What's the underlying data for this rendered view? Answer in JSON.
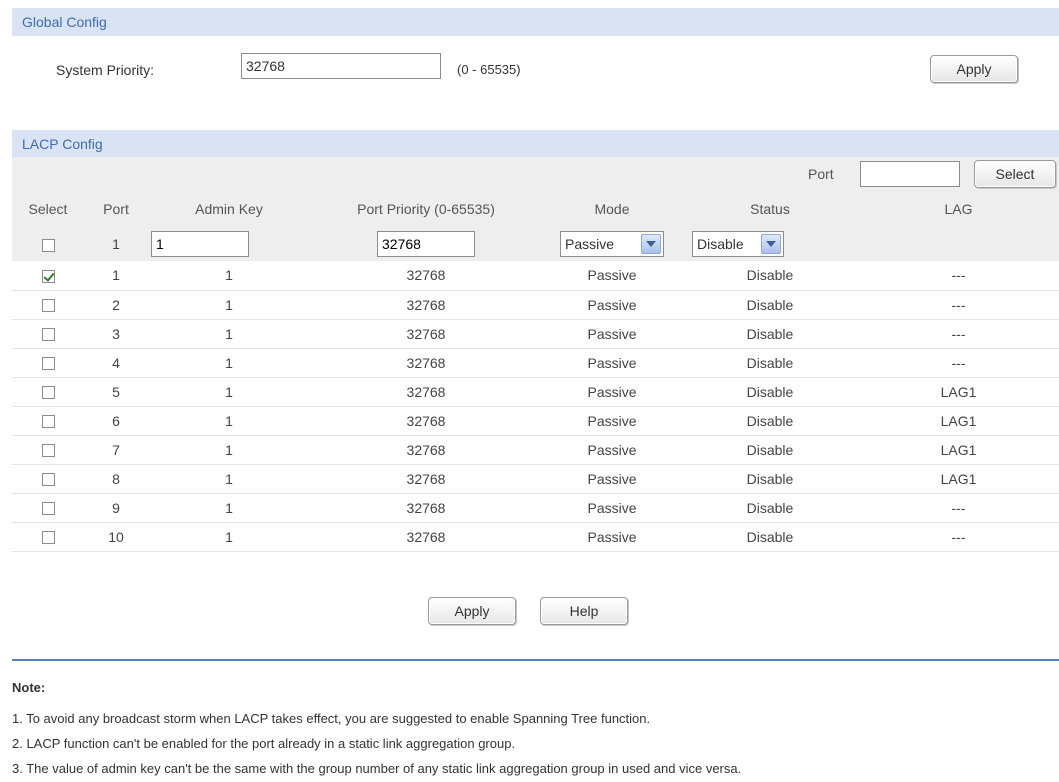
{
  "global": {
    "header": "Global Config",
    "priority_label": "System Priority:",
    "priority_value": "32768",
    "priority_range": "(0 - 65535)",
    "apply_label": "Apply"
  },
  "lacp": {
    "header": "LACP Config",
    "port_filter_label": "Port",
    "port_filter_value": "",
    "select_button": "Select",
    "columns": [
      "Select",
      "Port",
      "Admin Key",
      "Port Priority (0-65535)",
      "Mode",
      "Status",
      "LAG"
    ],
    "edit_row": {
      "port": "1",
      "admin_key": "1",
      "port_priority": "32768",
      "mode": "Passive",
      "status": "Disable"
    },
    "rows": [
      {
        "checked": true,
        "port": "1",
        "admin_key": "1",
        "priority": "32768",
        "mode": "Passive",
        "status": "Disable",
        "lag": "---"
      },
      {
        "checked": false,
        "port": "2",
        "admin_key": "1",
        "priority": "32768",
        "mode": "Passive",
        "status": "Disable",
        "lag": "---"
      },
      {
        "checked": false,
        "port": "3",
        "admin_key": "1",
        "priority": "32768",
        "mode": "Passive",
        "status": "Disable",
        "lag": "---"
      },
      {
        "checked": false,
        "port": "4",
        "admin_key": "1",
        "priority": "32768",
        "mode": "Passive",
        "status": "Disable",
        "lag": "---"
      },
      {
        "checked": false,
        "port": "5",
        "admin_key": "1",
        "priority": "32768",
        "mode": "Passive",
        "status": "Disable",
        "lag": "LAG1"
      },
      {
        "checked": false,
        "port": "6",
        "admin_key": "1",
        "priority": "32768",
        "mode": "Passive",
        "status": "Disable",
        "lag": "LAG1"
      },
      {
        "checked": false,
        "port": "7",
        "admin_key": "1",
        "priority": "32768",
        "mode": "Passive",
        "status": "Disable",
        "lag": "LAG1"
      },
      {
        "checked": false,
        "port": "8",
        "admin_key": "1",
        "priority": "32768",
        "mode": "Passive",
        "status": "Disable",
        "lag": "LAG1"
      },
      {
        "checked": false,
        "port": "9",
        "admin_key": "1",
        "priority": "32768",
        "mode": "Passive",
        "status": "Disable",
        "lag": "---"
      },
      {
        "checked": false,
        "port": "10",
        "admin_key": "1",
        "priority": "32768",
        "mode": "Passive",
        "status": "Disable",
        "lag": "---"
      }
    ],
    "apply_label": "Apply",
    "help_label": "Help"
  },
  "note": {
    "title": "Note:",
    "lines": [
      "1. To avoid any broadcast storm when LACP takes effect, you are suggested to enable Spanning Tree function.",
      "2. LACP function can't be enabled for the port already in a static link aggregation group.",
      "3. The value of admin key can't be the same with the group number of any static link aggregation group in used and vice versa."
    ]
  },
  "colors": {
    "header_bg": "#d9e3f4",
    "header_text": "#3f6db0",
    "row_bg": "#eeeeee",
    "divider": "#5a7fbf"
  }
}
